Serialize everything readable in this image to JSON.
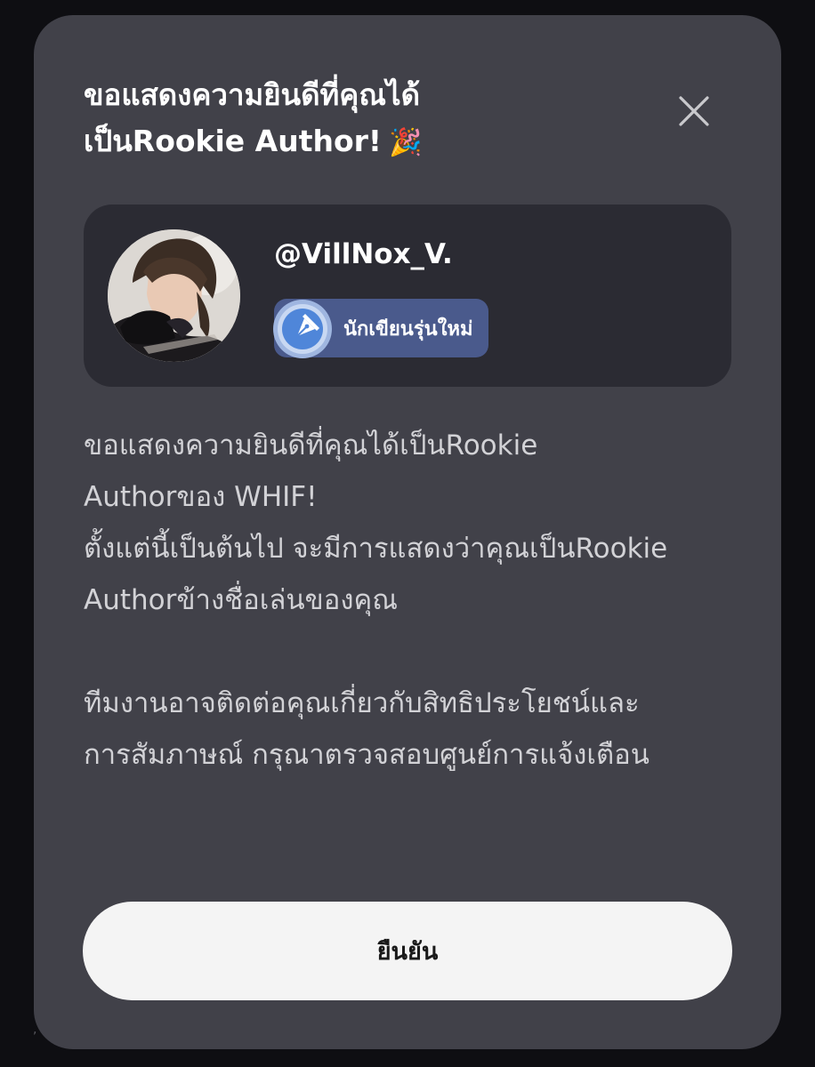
{
  "modal": {
    "title_line1": "ขอแสดงความยินดีที่คุณได้",
    "title_line2": "เป็นRookie Author!",
    "title_emoji": "🎉",
    "close_icon": "close-icon"
  },
  "profile": {
    "username": "@VillNox_V.",
    "avatar_icon": "avatar",
    "badge": {
      "label": "นักเขียนรุ่นใหม่",
      "icon": "fountain-pen-icon",
      "color": "#4a5a8c"
    }
  },
  "message": {
    "line1": "ขอแสดงความยินดีที่คุณได้เป็นRookie",
    "line2": "Authorของ WHIF!",
    "line3": "ตั้งแต่นี้เป็นต้นไป จะมีการแสดงว่าคุณเป็นRookie",
    "line4": "Authorข้างชื่อเล่นของคุณ",
    "line5": "ทีมงานอาจติดต่อคุณเกี่ยวกับสิทธิประโยชน์และ",
    "line6": "การสัมภาษณ์ กรุณาตรวจสอบศูนย์การแจ้งเตือน"
  },
  "actions": {
    "confirm_label": "ยืนยัน"
  },
  "colors": {
    "modal_bg": "#414149",
    "card_bg": "#2b2b33",
    "page_bg": "#0e0e12",
    "button_bg": "#f4f4f4"
  }
}
